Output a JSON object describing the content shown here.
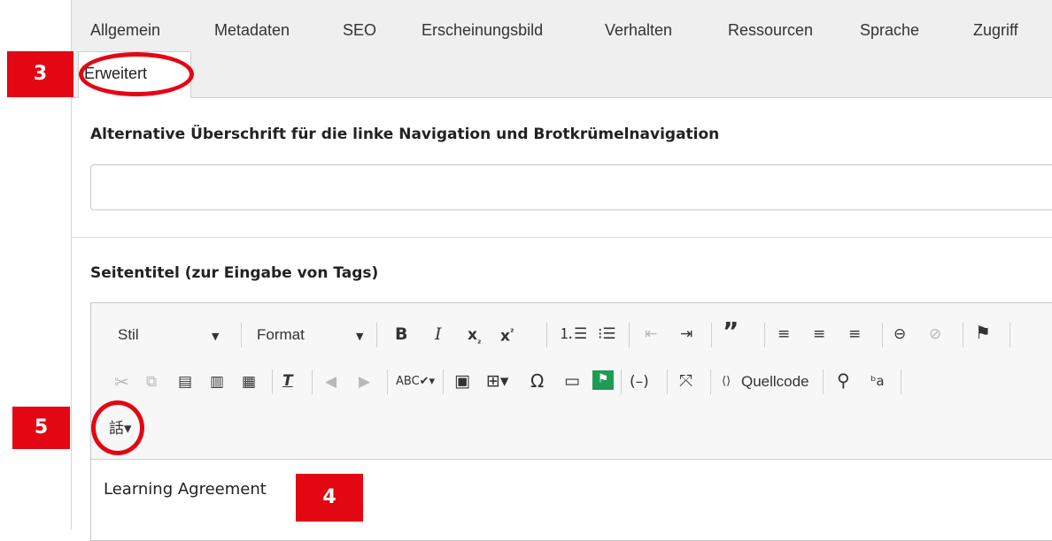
{
  "tabs": {
    "row1": [
      "Allgemein",
      "Metadaten",
      "SEO",
      "Erscheinungsbild",
      "Verhalten",
      "Ressourcen",
      "Sprache",
      "Zugriff"
    ],
    "active": "Erweitert"
  },
  "markers": {
    "m3": "3",
    "m4": "4",
    "m5": "5"
  },
  "field1": {
    "label": "Alternative Überschrift für die linke Navigation und Brotkrümelnavigation",
    "value": ""
  },
  "field2": {
    "label": "Seitentitel (zur Eingabe von Tags)"
  },
  "editor": {
    "style_dropdown": "Stil",
    "format_dropdown": "Format",
    "source_label": "Quellcode",
    "content": "Learning Agreement"
  },
  "colors": {
    "marker_red": "#e30613",
    "tab_bg": "#efefef"
  }
}
